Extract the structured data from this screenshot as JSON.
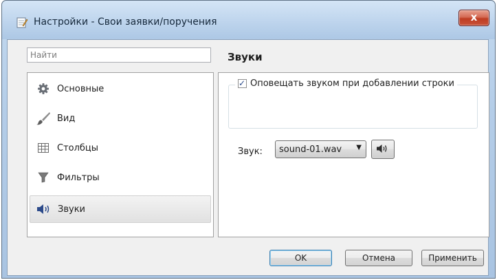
{
  "window": {
    "title": "Настройки - Свои заявки/поручения",
    "close_glyph": "x"
  },
  "search": {
    "placeholder": "Найти",
    "value": ""
  },
  "categories": [
    {
      "label": "Основные",
      "icon": "gear-icon",
      "selected": false
    },
    {
      "label": "Вид",
      "icon": "brush-icon",
      "selected": false
    },
    {
      "label": "Столбцы",
      "icon": "table-icon",
      "selected": false
    },
    {
      "label": "Фильтры",
      "icon": "filter-icon",
      "selected": false
    },
    {
      "label": "Звуки",
      "icon": "speaker-icon",
      "selected": true
    }
  ],
  "panel": {
    "title": "Звуки",
    "notify_checkbox": {
      "label": "Оповещать звуком при добавлении строки",
      "checked": true
    },
    "sound_label": "Звук:",
    "sound_select": {
      "value": "sound-01.wav"
    },
    "play_icon": "speaker-icon"
  },
  "buttons": {
    "ok": "OK",
    "cancel": "Отмена",
    "apply": "Применить"
  },
  "colors": {
    "title_bar": "#bcd3ec",
    "close_button": "#c8533a",
    "client_bg": "#f0f0f0",
    "default_button_border": "#3c7fb1"
  }
}
